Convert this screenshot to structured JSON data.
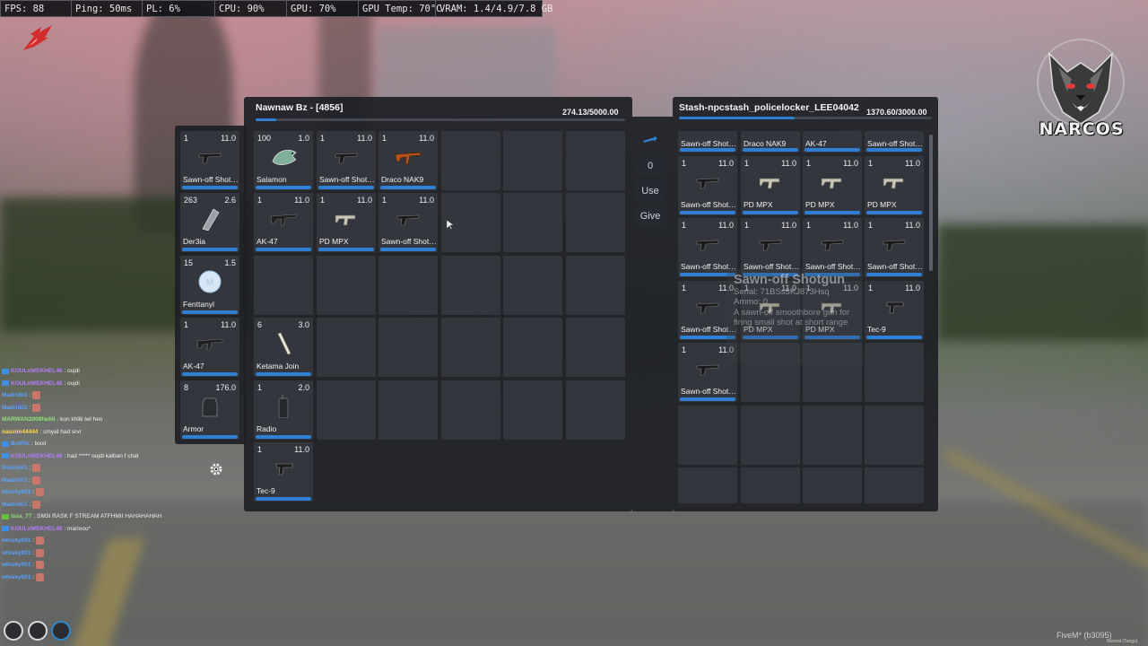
{
  "perf_bar": [
    "FPS: 88",
    "Ping: 50ms",
    "PL: 6%",
    "CPU: 90%",
    "GPU: 70%",
    "GPU Temp: 70°C",
    "VRAM: 1.4/4.9/7.8 GB"
  ],
  "logo": {
    "text": "NARCOS"
  },
  "player_inventory": {
    "title": "Nawnaw Bz - [4856]",
    "weight": "274.13/5000.00",
    "weight_fraction": 0.055
  },
  "hotbar": [
    {
      "qty": "1",
      "weight": "11.0",
      "name": "Sawn-off Shotgun",
      "icon": "shotgun-icon"
    },
    {
      "qty": "263",
      "weight": "2.6",
      "name": "Der3ia",
      "icon": "fish-icon"
    },
    {
      "qty": "15",
      "weight": "1.5",
      "name": "Fenttanyl",
      "icon": "pill-icon"
    },
    {
      "qty": "1",
      "weight": "11.0",
      "name": "AK-47",
      "icon": "rifle-icon"
    },
    {
      "qty": "8",
      "weight": "176.0",
      "name": "Armor",
      "icon": "armor-icon"
    }
  ],
  "main_items": [
    {
      "qty": "100",
      "weight": "1.0",
      "name": "Salamon",
      "icon": "salmon-icon"
    },
    {
      "qty": "1",
      "weight": "11.0",
      "name": "Sawn-off Shotgun",
      "icon": "shotgun-icon"
    },
    {
      "qty": "1",
      "weight": "11.0",
      "name": "Draco NAK9",
      "icon": "draco-icon"
    },
    {
      "qty": "1",
      "weight": "11.0",
      "name": "AK-47",
      "icon": "rifle-icon"
    },
    {
      "qty": "1",
      "weight": "11.0",
      "name": "PD MPX",
      "icon": "smg-icon"
    },
    {
      "qty": "1",
      "weight": "11.0",
      "name": "Sawn-off Shotgun",
      "icon": "shotgun-icon"
    },
    {
      "qty": "6",
      "weight": "3.0",
      "name": "Ketama Join",
      "icon": "joint-icon"
    },
    {
      "qty": "1",
      "weight": "2.0",
      "name": "Radio",
      "icon": "radio-icon"
    },
    {
      "qty": "1",
      "weight": "11.0",
      "name": "Tec-9",
      "icon": "pistol-icon"
    }
  ],
  "middle_controls": {
    "amount": "0",
    "use_label": "Use",
    "give_label": "Give"
  },
  "stash": {
    "title": "Stash-npcstash_policelocker_LEE04042",
    "weight": "1370.60/3000.00",
    "weight_fraction": 0.457,
    "top_row": [
      "Sawn-off Shotgun",
      "Draco NAK9",
      "AK-47",
      "Sawn-off Shotgun"
    ],
    "items": [
      {
        "qty": "1",
        "weight": "11.0",
        "name": "Sawn-off Shotgun",
        "icon": "shotgun-icon"
      },
      {
        "qty": "1",
        "weight": "11.0",
        "name": "PD MPX",
        "icon": "smg-icon"
      },
      {
        "qty": "1",
        "weight": "11.0",
        "name": "PD MPX",
        "icon": "smg-icon"
      },
      {
        "qty": "1",
        "weight": "11.0",
        "name": "PD MPX",
        "icon": "smg-icon"
      },
      {
        "qty": "1",
        "weight": "11.0",
        "name": "Sawn-off Shotgun",
        "icon": "shotgun-icon"
      },
      {
        "qty": "1",
        "weight": "11.0",
        "name": "Sawn-off Shotgun",
        "icon": "shotgun-icon"
      },
      {
        "qty": "1",
        "weight": "11.0",
        "name": "Sawn-off Shotgun",
        "icon": "shotgun-icon"
      },
      {
        "qty": "1",
        "weight": "11.0",
        "name": "Sawn-off Shotgun",
        "icon": "shotgun-icon"
      },
      {
        "qty": "1",
        "weight": "11.0",
        "name": "Sawn-off Shotgun",
        "icon": "shotgun-icon"
      },
      {
        "qty": "1",
        "weight": "11.0",
        "name": "PD MPX",
        "icon": "smg-icon"
      },
      {
        "qty": "1",
        "weight": "11.0",
        "name": "PD MPX",
        "icon": "smg-icon"
      },
      {
        "qty": "1",
        "weight": "11.0",
        "name": "Tec-9",
        "icon": "pistol-icon"
      },
      {
        "qty": "1",
        "weight": "11.0",
        "name": "Sawn-off Shotgun",
        "icon": "shotgun-icon"
      }
    ]
  },
  "tooltip": {
    "title": "Sawn-off Shotgun",
    "serial": "Serial: 71BSs5KJ873Hsq",
    "ammo": "Ammo: 0",
    "description": "A sawn-off smoothbore gun for firing small shot at short range"
  },
  "chat": [
    {
      "name": "KOULxWEKHEL48",
      "msg": ": oujdi",
      "color": "#b57cff",
      "badge": "#3e8ee6"
    },
    {
      "name": "KOULxWEKHEL48",
      "msg": ": oujdi",
      "color": "#b57cff",
      "badge": "#3e8ee6"
    },
    {
      "name": "Madridii1",
      "msg": ":",
      "color": "#5aa2ff",
      "emote": true
    },
    {
      "name": "Madridii1",
      "msg": ":",
      "color": "#5aa2ff",
      "emote": true
    },
    {
      "name": "MARWAN2008fadili",
      "msg": ": kon khliti lwl hen",
      "color": "#8fe07a"
    },
    {
      "name": "nassim44444",
      "msg": ": smyat had srvr",
      "color": "#ffd94a"
    },
    {
      "name": "BotRix",
      "msg": ": lxxxl",
      "color": "#5aa2ff",
      "badge": "#3e8ee6"
    },
    {
      "name": "KOULxWEKHEL48",
      "msg": ": had ***** oujdi kalban f chat",
      "color": "#b57cff",
      "badge": "#3e8ee6"
    },
    {
      "name": "Madridii1",
      "msg": ":",
      "color": "#5aa2ff",
      "emote": true
    },
    {
      "name": "Madridii1",
      "msg": ":",
      "color": "#5aa2ff",
      "emote": true
    },
    {
      "name": "whisky001",
      "msg": ":",
      "color": "#5aa2ff",
      "emote": true
    },
    {
      "name": "Madridii1",
      "msg": ":",
      "color": "#5aa2ff",
      "emote": true
    },
    {
      "name": "issa_77",
      "msg": ": SM3I RASK F STREAM ATFHMII HAHAHAHAH",
      "color": "#8fe07a",
      "badge": "#67c23a"
    },
    {
      "name": "KOULxWEKHEL48",
      "msg": ": mariooo*",
      "color": "#b57cff",
      "badge": "#3e8ee6"
    },
    {
      "name": "whisky001",
      "msg": ":",
      "color": "#5aa2ff",
      "emote": true
    },
    {
      "name": "whisky001",
      "msg": ":",
      "color": "#5aa2ff",
      "emote": true
    },
    {
      "name": "whisky001",
      "msg": ":",
      "color": "#5aa2ff",
      "emote": true
    },
    {
      "name": "whisky001",
      "msg": ":",
      "color": "#5aa2ff",
      "emote": true
    }
  ],
  "footer": {
    "label": "FiveM* (b3095)",
    "sub": "Normal (Tango)"
  },
  "colors": {
    "accent": "#2f7fd4",
    "panel": "#1e2026",
    "slot": "#33363d"
  }
}
